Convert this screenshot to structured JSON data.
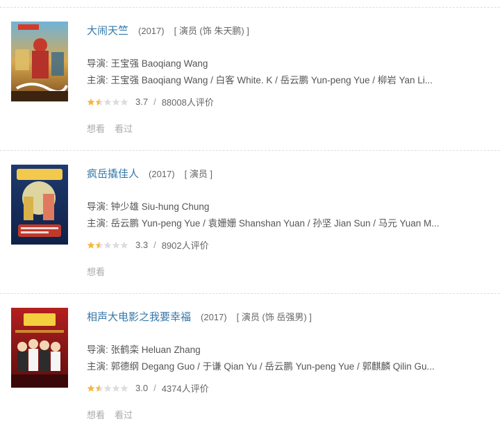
{
  "colors": {
    "title_link": "#3377aa",
    "star_filled": "#f5b73e",
    "star_empty": "#dddddd"
  },
  "movies": [
    {
      "title": "大闹天竺",
      "year": "(2017)",
      "role": "[ 演员 (饰 朱天鹏) ]",
      "director_label": "导演:",
      "director": "王宝强 Baoqiang Wang",
      "cast_label": "主演:",
      "cast": "王宝强 Baoqiang Wang / 白客 White. K / 岳云鹏 Yun-peng Yue / 柳岩 Yan Li...",
      "rating": 3.7,
      "rating_text": "3.7",
      "slash": "/",
      "votes": "88008人评价",
      "stars_full": 1,
      "stars_half": 1,
      "actions": [
        "想看",
        "看过"
      ]
    },
    {
      "title": "疯岳撬佳人",
      "year": "(2017)",
      "role": "[ 演员 ]",
      "director_label": "导演:",
      "director": "钟少雄 Siu-hung Chung",
      "cast_label": "主演:",
      "cast": "岳云鹏 Yun-peng Yue / 袁姗姗 Shanshan Yuan / 孙坚 Jian Sun / 马元 Yuan M...",
      "rating": 3.3,
      "rating_text": "3.3",
      "slash": "/",
      "votes": "8902人评价",
      "stars_full": 1,
      "stars_half": 1,
      "actions": [
        "想看"
      ]
    },
    {
      "title": "相声大电影之我要幸福",
      "year": "(2017)",
      "role": "[ 演员 (饰 岳强男) ]",
      "director_label": "导演:",
      "director": "张鹤栾 Heluan Zhang",
      "cast_label": "主演:",
      "cast": "郭德纲 Degang Guo / 于谦 Qian Yu / 岳云鹏 Yun-peng Yue / 郭麒麟 Qilin Gu...",
      "rating": 3.0,
      "rating_text": "3.0",
      "slash": "/",
      "votes": "4374人评价",
      "stars_full": 1,
      "stars_half": 1,
      "actions": [
        "想看",
        "看过"
      ]
    }
  ]
}
